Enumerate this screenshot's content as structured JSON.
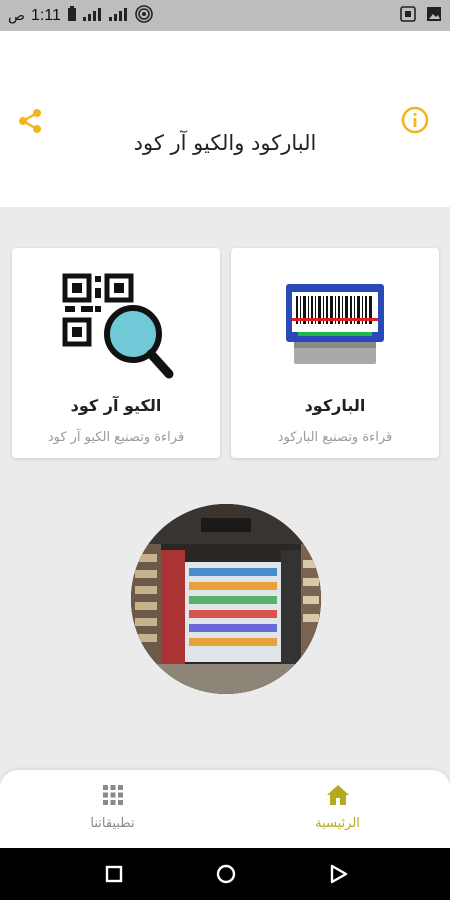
{
  "status_bar": {
    "time": "1:11",
    "period": "ص"
  },
  "header": {
    "title": "الباركود والكيو آر كود",
    "accent_color": "#f3b51d"
  },
  "cards": [
    {
      "title": "الباركود",
      "subtitle": "قراءة وتصنيع الباركود",
      "icon": "barcode-scanner-icon"
    },
    {
      "title": "الكيو آر كود",
      "subtitle": "قراءة وتصنيع الكيو آر كود",
      "icon": "qr-magnifier-icon"
    }
  ],
  "bottom_nav": {
    "items": [
      {
        "label": "الرئيسية",
        "icon": "home-icon",
        "active": true
      },
      {
        "label": "تطبيقاتنا",
        "icon": "apps-grid-icon",
        "active": false
      }
    ],
    "active_color": "#b3aa1f"
  }
}
